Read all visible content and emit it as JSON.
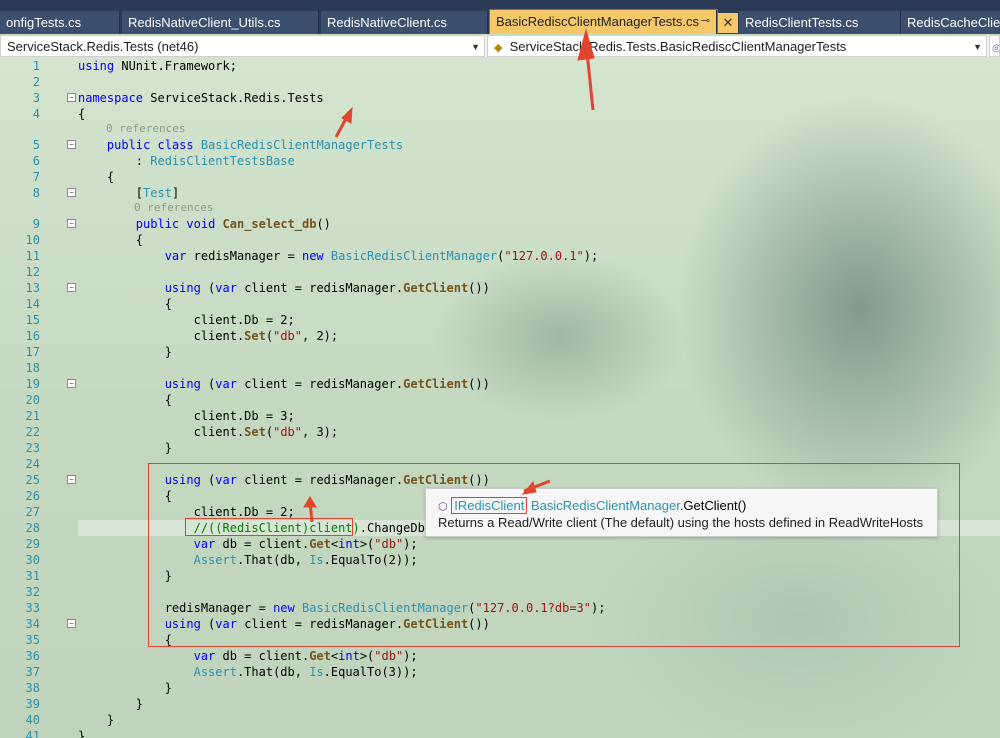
{
  "tabs": [
    {
      "label": "onfigTests.cs"
    },
    {
      "label": "RedisNativeClient_Utils.cs"
    },
    {
      "label": "RedisNativeClient.cs"
    },
    {
      "label": "BasicRediscClientManagerTests.cs"
    },
    {
      "label": "RedisClientTests.cs"
    },
    {
      "label": "RedisCacheClier"
    }
  ],
  "tab_pin": "⊸",
  "tab_close": "✕",
  "navbar": {
    "project": "ServiceStack.Redis.Tests (net46)",
    "type_path": "ServiceStack.Redis.Tests.BasicRediscClientManagerTests"
  },
  "editor": {
    "line_numbers": [
      "1",
      "2",
      "3",
      "4",
      "5",
      "6",
      "7",
      "8",
      "9",
      "10",
      "11",
      "12",
      "13",
      "14",
      "15",
      "16",
      "17",
      "18",
      "19",
      "20",
      "21",
      "22",
      "23",
      "24",
      "25",
      "26",
      "27",
      "28",
      "29",
      "30",
      "31",
      "32",
      "33",
      "34",
      "35",
      "36",
      "37",
      "38",
      "39",
      "40",
      "41"
    ],
    "references_label": "0 references"
  },
  "tooltip": {
    "type": "IRedisClient",
    "method_owner": "BasicRedisClientManager",
    "method": ".GetClient()",
    "description": "Returns a Read/Write client (The default) using the hosts defined in ReadWriteHosts"
  },
  "colors": {
    "tab_active": "#f5c86a",
    "tab_bar": "#2b3a55",
    "annotation_red": "#e0452e",
    "keyword": "#0000ff",
    "type": "#2b91af",
    "string": "#a31515",
    "comment": "#008000"
  }
}
